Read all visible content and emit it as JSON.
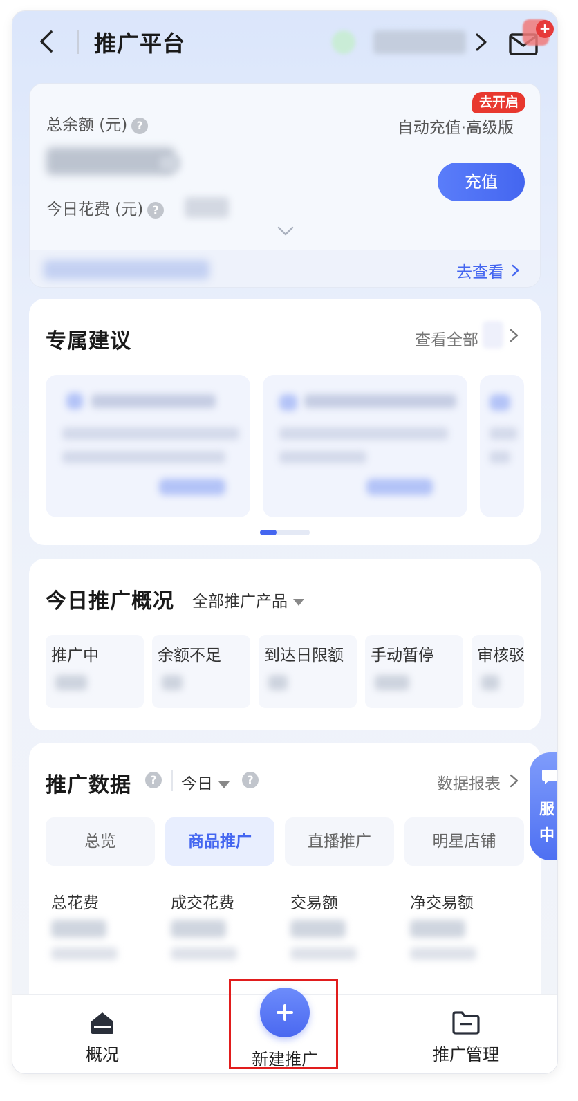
{
  "header": {
    "title": "推广平台"
  },
  "balance": {
    "total_label": "总余额 (元)",
    "spend_label": "今日花费 (元)",
    "badge": "去开启",
    "auto_recharge": "自动充值·高级版",
    "recharge_button": "充值",
    "view_link": "去查看"
  },
  "suggestions": {
    "title": "专属建议",
    "view_all": "查看全部"
  },
  "overview": {
    "title": "今日推广概况",
    "filter": "全部推广产品",
    "statuses": [
      "推广中",
      "余额不足",
      "到达日限额",
      "手动暂停",
      "审核驳"
    ]
  },
  "promo_data": {
    "title": "推广数据",
    "period": "今日",
    "report_link": "数据报表",
    "tabs": [
      "总览",
      "商品推广",
      "直播推广",
      "明星店铺"
    ],
    "active_tab": "商品推广",
    "metrics": [
      "总花费",
      "成交花费",
      "交易额",
      "净交易额"
    ]
  },
  "service_float": {
    "line1": "服",
    "line2": "中"
  },
  "bottom_nav": {
    "overview": "概况",
    "new_promo": "新建推广",
    "manage": "推广管理"
  },
  "colors": {
    "accent": "#4466f0",
    "badge_red": "#e8382f",
    "highlight": "#e11d1d"
  }
}
